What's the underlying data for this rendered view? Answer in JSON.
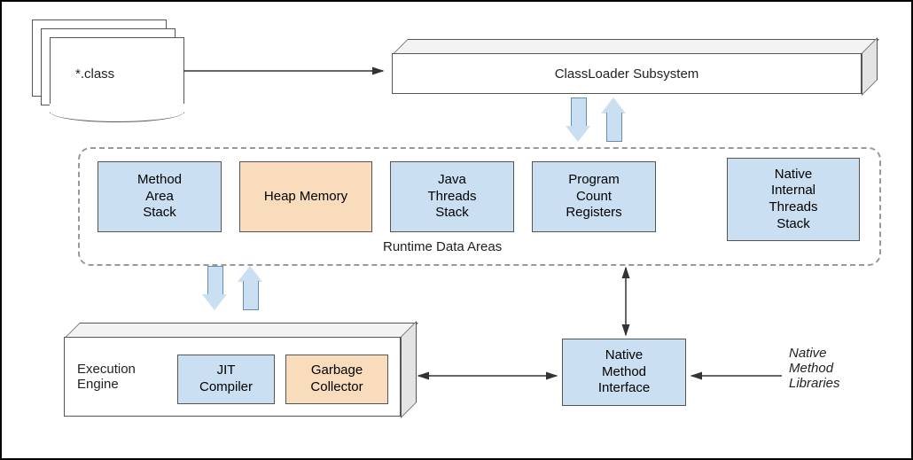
{
  "input": {
    "label": "*.class"
  },
  "classloader": {
    "label": "ClassLoader Subsystem"
  },
  "runtime": {
    "title": "Runtime Data Areas",
    "boxes": {
      "method": "Method\nArea\nStack",
      "heap": "Heap Memory",
      "threads": "Java\nThreads\nStack",
      "pc": "Program\nCount\nRegisters",
      "native": "Native\nInternal\nThreads\nStack"
    }
  },
  "exec": {
    "label": "Execution\nEngine",
    "jit": "JIT\nCompiler",
    "gc": "Garbage\nCollector"
  },
  "nmi": {
    "label": "Native\nMethod\nInterface"
  },
  "nml": {
    "label": "Native\nMethod\nLibraries"
  }
}
